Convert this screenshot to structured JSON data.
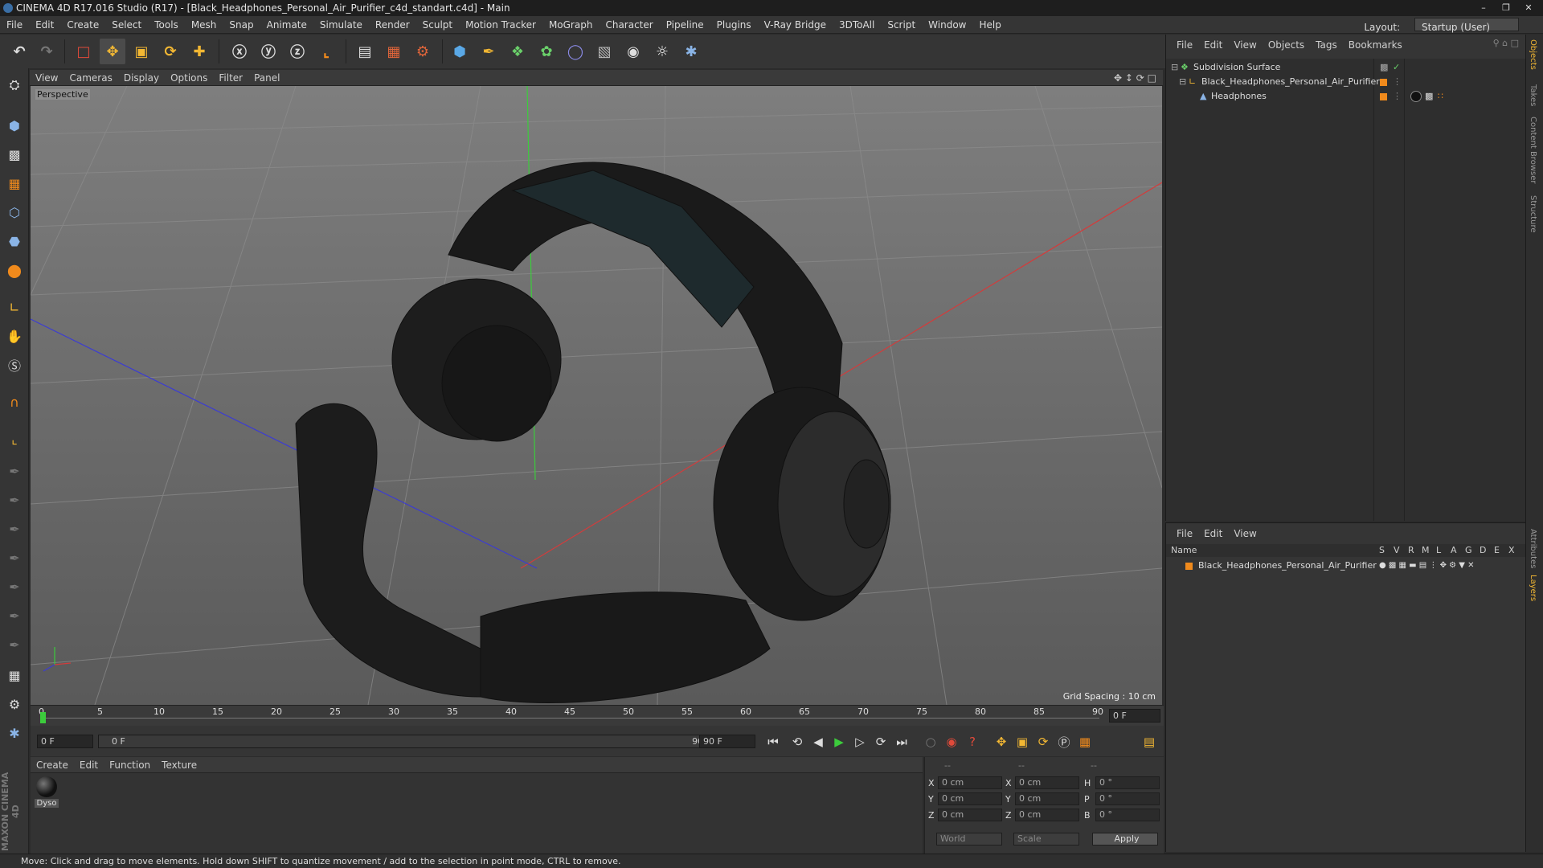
{
  "window": {
    "title": "CINEMA 4D R17.016 Studio (R17) - [Black_Headphones_Personal_Air_Purifier_c4d_standart.c4d] - Main"
  },
  "menubar": {
    "items": [
      "File",
      "Edit",
      "Create",
      "Select",
      "Tools",
      "Mesh",
      "Snap",
      "Animate",
      "Simulate",
      "Render",
      "Sculpt",
      "Motion Tracker",
      "MoGraph",
      "Character",
      "Pipeline",
      "Plugins",
      "V-Ray Bridge",
      "3DToAll",
      "Script",
      "Window",
      "Help"
    ],
    "layout_label": "Layout:",
    "layout_value": "Startup (User)"
  },
  "viewport": {
    "menu": [
      "View",
      "Cameras",
      "Display",
      "Options",
      "Filter",
      "Panel"
    ],
    "label": "Perspective",
    "grid_spacing": "Grid Spacing : 10 cm"
  },
  "timeline": {
    "ticks": [
      "0",
      "5",
      "10",
      "15",
      "20",
      "25",
      "30",
      "35",
      "40",
      "45",
      "50",
      "55",
      "60",
      "65",
      "70",
      "75",
      "80",
      "85",
      "90"
    ],
    "current_frame": "0 F",
    "start_frame": "0 F",
    "range_start": "0 F",
    "range_end": "90 F",
    "end_frame": "90 F"
  },
  "material_manager": {
    "menu": [
      "Create",
      "Edit",
      "Function",
      "Texture"
    ],
    "materials": [
      {
        "name": "Dyso"
      }
    ]
  },
  "coordinates": {
    "header": [
      "--",
      "--",
      "--"
    ],
    "rows": [
      {
        "a": "X",
        "av": "0 cm",
        "b": "X",
        "bv": "0 cm",
        "c": "H",
        "cv": "0 °"
      },
      {
        "a": "Y",
        "av": "0 cm",
        "b": "Y",
        "bv": "0 cm",
        "c": "P",
        "cv": "0 °"
      },
      {
        "a": "Z",
        "av": "0 cm",
        "b": "Z",
        "bv": "0 cm",
        "c": "B",
        "cv": "0 °"
      }
    ],
    "world": "World",
    "scale": "Scale",
    "apply": "Apply"
  },
  "object_manager": {
    "menu": [
      "File",
      "Edit",
      "View",
      "Objects",
      "Tags",
      "Bookmarks"
    ],
    "objects": [
      {
        "name": "Subdivision Surface"
      },
      {
        "name": "Black_Headphones_Personal_Air_Purifier"
      },
      {
        "name": "Headphones"
      }
    ]
  },
  "layer_manager": {
    "menu": [
      "File",
      "Edit",
      "View"
    ],
    "name_header": "Name",
    "flags": [
      "S",
      "V",
      "R",
      "M",
      "L",
      "A",
      "G",
      "D",
      "E",
      "X"
    ],
    "layers": [
      {
        "name": "Black_Headphones_Personal_Air_Purifier"
      }
    ]
  },
  "right_tabs": [
    "Objects",
    "Takes",
    "Content Browser",
    "Structure",
    "Attributes",
    "Layers"
  ],
  "branding": "MAXON CINEMA 4D",
  "status": "Move: Click and drag to move elements. Hold down SHIFT to quantize movement / add to the selection in point mode, CTRL to remove.",
  "colors": {
    "accent": "#f08a1c",
    "x_axis": "#d23c3c",
    "y_axis": "#3ccc3c",
    "z_axis": "#3c3cd2"
  }
}
